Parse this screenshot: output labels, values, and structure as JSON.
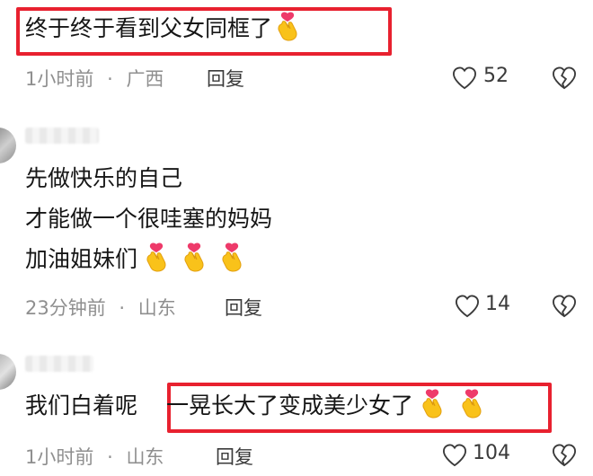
{
  "comments": [
    {
      "text": "终于终于看到父女同框了",
      "time": "1小时前",
      "location": "广西",
      "reply_label": "回复",
      "likes": "52"
    },
    {
      "lines": [
        "先做快乐的自己",
        "才能做一个很哇塞的妈妈",
        "加油姐妹们"
      ],
      "time": "23分钟前",
      "location": "山东",
      "reply_label": "回复",
      "likes": "14"
    },
    {
      "text_prefix": "我们白着呢",
      "text_highlight": "一晃长大了变成美少女了",
      "time": "1小时前",
      "location": "山东",
      "reply_label": "回复",
      "likes": "104"
    }
  ],
  "separator": "·",
  "colors": {
    "highlight_border": "#e8212f",
    "meta_text": "#8f8f8f",
    "main_text": "#161616"
  },
  "icons": {
    "like": "heart-outline-icon",
    "dislike": "broken-heart-icon",
    "emoji": "finger-heart-emoji"
  }
}
